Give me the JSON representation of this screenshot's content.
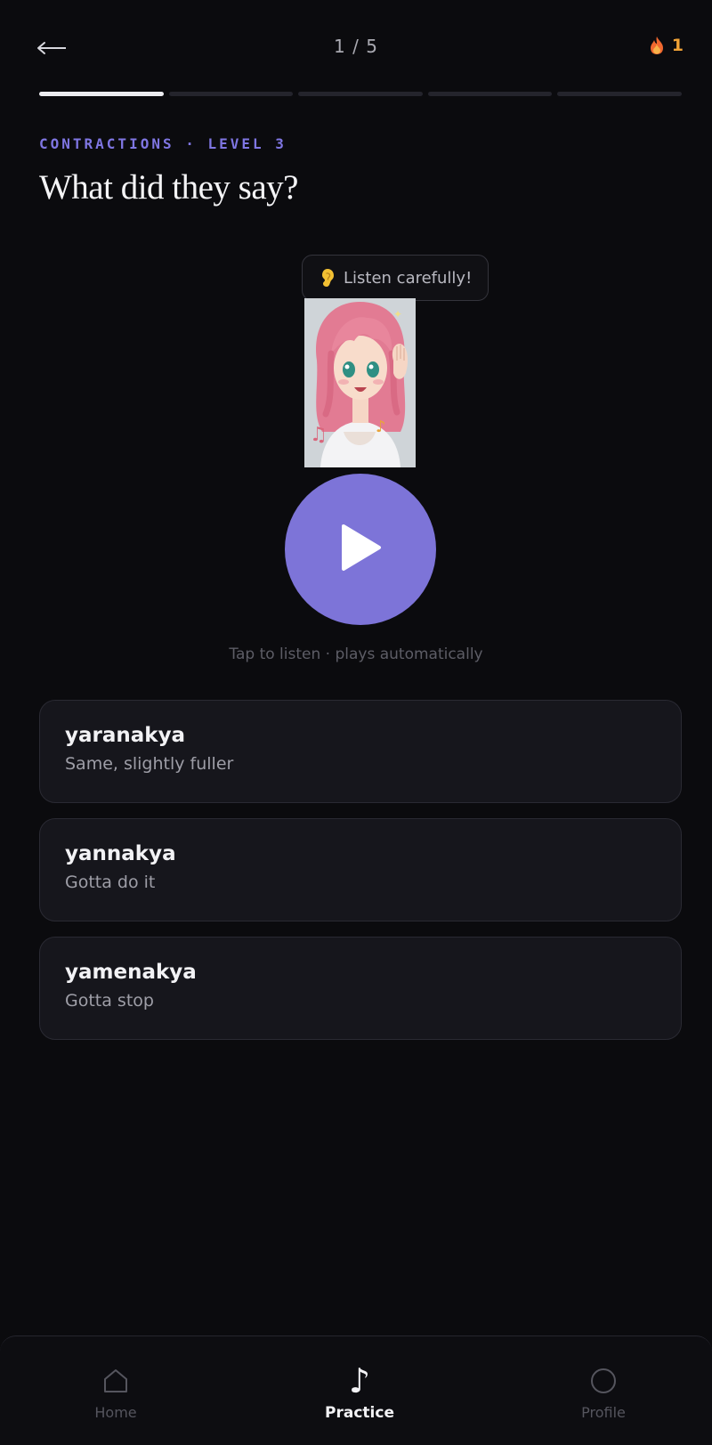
{
  "header": {
    "back_icon": "arrow-left-icon",
    "counter": "1 / 5",
    "streak": {
      "icon": "flame-icon",
      "count": "1",
      "color": "#f0a236"
    }
  },
  "progress": {
    "total": 5,
    "completed": 1
  },
  "question": {
    "eyebrow": "CONTRACTIONS · LEVEL 3",
    "title": "What did they say?"
  },
  "speech": {
    "icon": "ear-icon",
    "text": "Listen carefully!"
  },
  "character": {
    "icon": "anime-girl-listening-illustration"
  },
  "player": {
    "icon": "play-icon",
    "hint": "Tap to listen · plays automatically",
    "color": "#7d74d8"
  },
  "options": [
    {
      "word": "yaranakya",
      "gloss": "Same, slightly fuller"
    },
    {
      "word": "yannakya",
      "gloss": "Gotta do it"
    },
    {
      "word": "yamenakya",
      "gloss": "Gotta stop"
    }
  ],
  "nav": {
    "items": [
      {
        "label": "Home",
        "icon": "home-icon"
      },
      {
        "label": "Practice",
        "icon": "music-note-icon",
        "active": true
      },
      {
        "label": "Profile",
        "icon": "profile-circle-icon"
      }
    ]
  },
  "colors": {
    "background": "#0b0b0e",
    "accent": "#7f76e2",
    "card": "#16161c"
  }
}
